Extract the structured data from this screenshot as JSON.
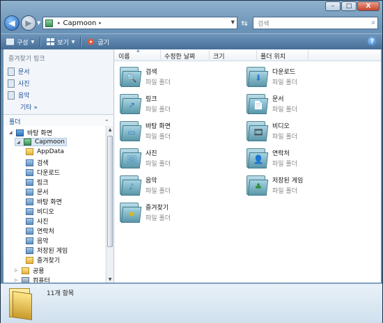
{
  "window": {
    "minimize": "–",
    "maximize": "□",
    "close": "X"
  },
  "address": {
    "crumbs": [
      "Capmoon"
    ],
    "separator": "▸",
    "search_placeholder": "검색"
  },
  "toolbar": {
    "organize": "구성",
    "views": "보기",
    "burn": "굽기",
    "help": "?"
  },
  "favorites": {
    "title": "즐겨찾기 링크",
    "items": [
      {
        "label": "문서"
      },
      {
        "label": "사진"
      },
      {
        "label": "음악"
      }
    ],
    "more": "기타",
    "more_arrow": "»"
  },
  "folders_header": "폴더",
  "tree": [
    {
      "label": "바탕 화면",
      "icon": "desktop-icon"
    },
    {
      "label": "Capmoon",
      "icon": "user-folder-icon"
    },
    {
      "label": "AppData",
      "icon": "folder-icon"
    },
    {
      "label": "검색",
      "icon": "search-folder-icon"
    },
    {
      "label": "다운로드",
      "icon": "downloads-folder-icon"
    },
    {
      "label": "링크",
      "icon": "links-folder-icon"
    },
    {
      "label": "문서",
      "icon": "documents-folder-icon"
    },
    {
      "label": "바탕 화면",
      "icon": "desktop-folder-icon"
    },
    {
      "label": "비디오",
      "icon": "videos-folder-icon"
    },
    {
      "label": "사진",
      "icon": "pictures-folder-icon"
    },
    {
      "label": "연락처",
      "icon": "contacts-folder-icon"
    },
    {
      "label": "음악",
      "icon": "music-folder-icon"
    },
    {
      "label": "저장된 게임",
      "icon": "saved-games-folder-icon"
    },
    {
      "label": "즐겨찾기",
      "icon": "favorites-folder-icon"
    },
    {
      "label": "공용",
      "icon": "public-folder-icon"
    },
    {
      "label": "컴퓨터",
      "icon": "computer-icon"
    }
  ],
  "columns": [
    "이름",
    "수정한 날짜",
    "크기",
    "폴더 위치"
  ],
  "items": [
    {
      "name": "검색",
      "type": "파일 폴더",
      "emblem": "🔍"
    },
    {
      "name": "다운로드",
      "type": "파일 폴더",
      "emblem": "⬇"
    },
    {
      "name": "링크",
      "type": "파일 폴더",
      "emblem": "↗"
    },
    {
      "name": "문서",
      "type": "파일 폴더",
      "emblem": "📄"
    },
    {
      "name": "바탕 화면",
      "type": "파일 폴더",
      "emblem": "▭"
    },
    {
      "name": "비디오",
      "type": "파일 폴더",
      "emblem": "🎞"
    },
    {
      "name": "사진",
      "type": "파일 폴더",
      "emblem": "🖼"
    },
    {
      "name": "연락처",
      "type": "파일 폴더",
      "emblem": "👤"
    },
    {
      "name": "음악",
      "type": "파일 폴더",
      "emblem": "♪"
    },
    {
      "name": "저장된 게임",
      "type": "파일 폴더",
      "emblem": "♣"
    },
    {
      "name": "즐겨찾기",
      "type": "파일 폴더",
      "emblem": "★"
    }
  ],
  "status": {
    "count": "11개 항목"
  }
}
